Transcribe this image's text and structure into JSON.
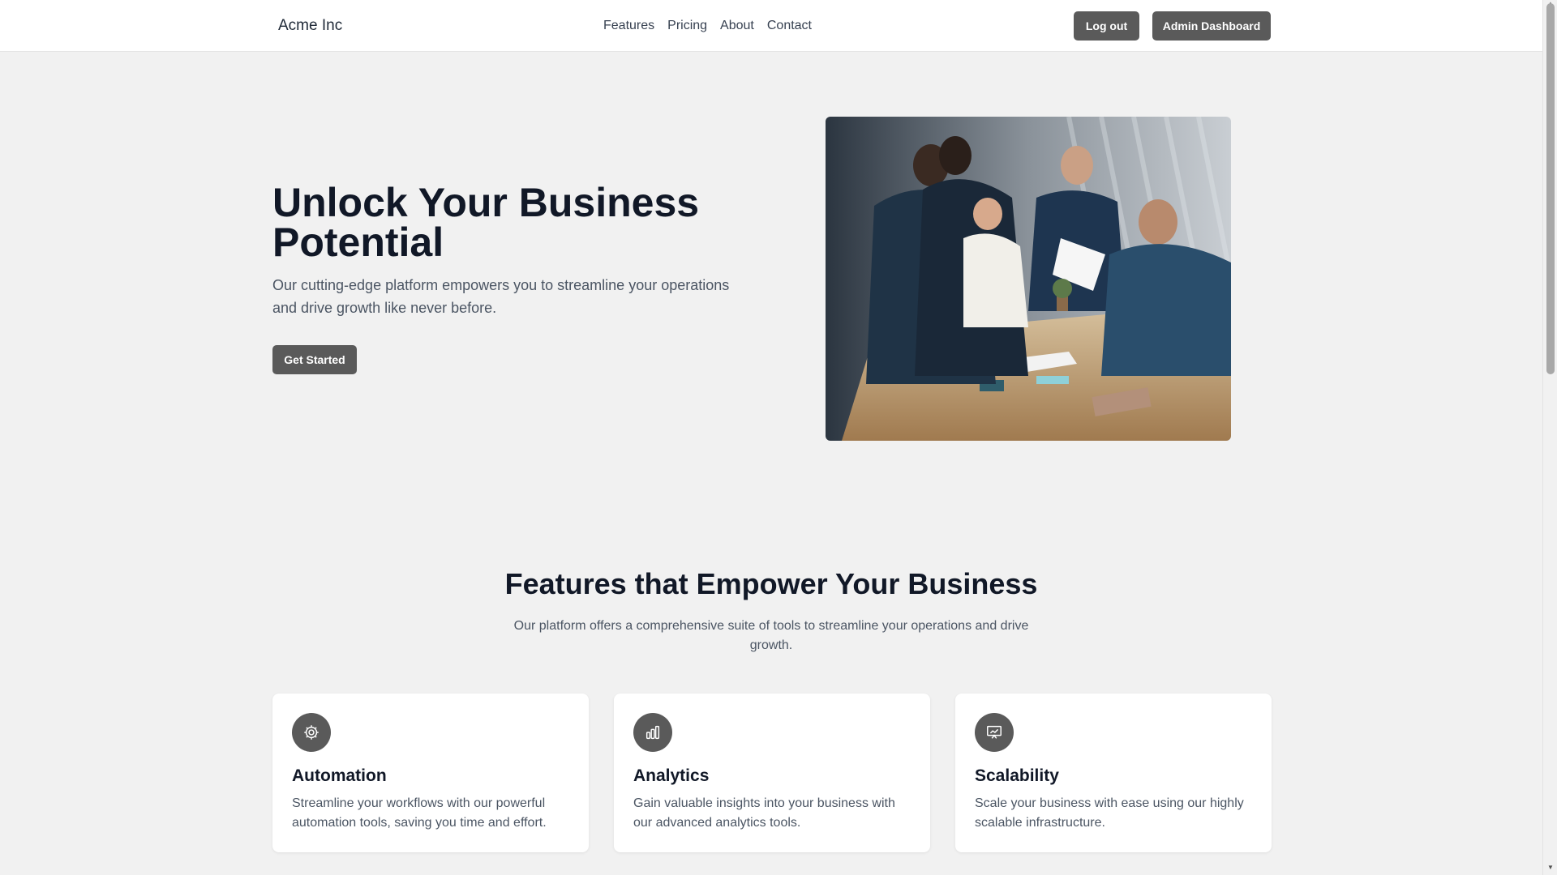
{
  "nav": {
    "brand": "Acme Inc",
    "links": [
      "Features",
      "Pricing",
      "About",
      "Contact"
    ],
    "logout_label": "Log out",
    "admin_label": "Admin Dashboard"
  },
  "hero": {
    "title": "Unlock Your Business Potential",
    "subtitle": "Our cutting-edge platform empowers you to streamline your operations and drive growth like never before.",
    "cta_label": "Get Started"
  },
  "features": {
    "title": "Features that Empower Your Business",
    "subtitle": "Our platform offers a comprehensive suite of tools to streamline your operations and drive growth.",
    "cards": [
      {
        "icon": "gear-icon",
        "title": "Automation",
        "description": "Streamline your workflows with our powerful automation tools, saving you time and effort."
      },
      {
        "icon": "bar-chart-icon",
        "title": "Analytics",
        "description": "Gain valuable insights into your business with our advanced analytics tools."
      },
      {
        "icon": "presentation-chart-icon",
        "title": "Scalability",
        "description": "Scale your business with ease using our highly scalable infrastructure."
      }
    ]
  },
  "colors": {
    "background": "#f1f1f1",
    "button": "#5a5a5a",
    "heading": "#111827",
    "body_text": "#4b5563"
  }
}
